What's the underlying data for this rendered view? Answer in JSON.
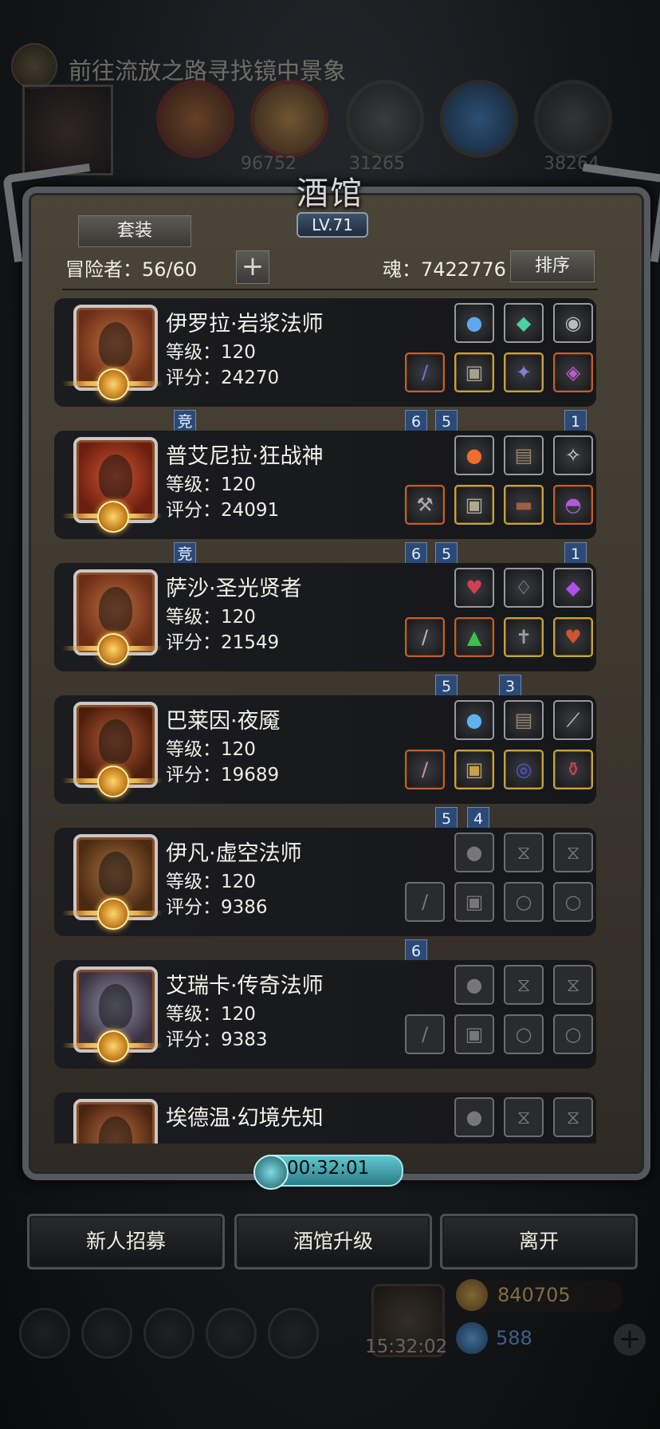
{
  "quest": {
    "text": "前往流放之路寻找镜中景象"
  },
  "resources": [
    "96752",
    "31265",
    "38264"
  ],
  "panel": {
    "title": "酒馆",
    "level": "LV.71",
    "suit_label": "套装",
    "adventurers_label": "冒险者：56/60",
    "plus_label": "+",
    "soul_label": "魂：7422776",
    "sort_label": "排序"
  },
  "heroes": [
    {
      "name": "伊罗拉·岩浆法师",
      "level": "等级：120",
      "score": "评分：24270",
      "flags": [
        {
          "text": "竞"
        },
        {
          "text": "6"
        },
        {
          "text": "5"
        },
        {
          "text": "1"
        }
      ]
    },
    {
      "name": "普艾尼拉·狂战神",
      "level": "等级：120",
      "score": "评分：24091",
      "flags": [
        {
          "text": "竞"
        },
        {
          "text": "6"
        },
        {
          "text": "5"
        },
        {
          "text": "1"
        }
      ]
    },
    {
      "name": "萨沙·圣光贤者",
      "level": "等级：120",
      "score": "评分：21549",
      "flags": [
        {
          "text": "5"
        },
        {
          "text": "3"
        }
      ]
    },
    {
      "name": "巴莱因·夜魇",
      "level": "等级：120",
      "score": "评分：19689",
      "flags": [
        {
          "text": "5"
        },
        {
          "text": "4"
        }
      ]
    },
    {
      "name": "伊凡·虚空法师",
      "level": "等级：120",
      "score": "评分：9386",
      "flags": [
        {
          "text": "6"
        }
      ]
    },
    {
      "name": "艾瑞卡·传奇法师",
      "level": "等级：120",
      "score": "评分：9383",
      "flags": []
    },
    {
      "name": "埃德温·幻境先知",
      "level": "",
      "score": "",
      "flags": []
    }
  ],
  "timer": "00:32:01",
  "buttons": {
    "recruit": "新人招募",
    "upgrade": "酒馆升级",
    "leave": "离开"
  },
  "bottom": {
    "gift_time": "15:32:02",
    "gold": "840705",
    "gems": "588"
  }
}
